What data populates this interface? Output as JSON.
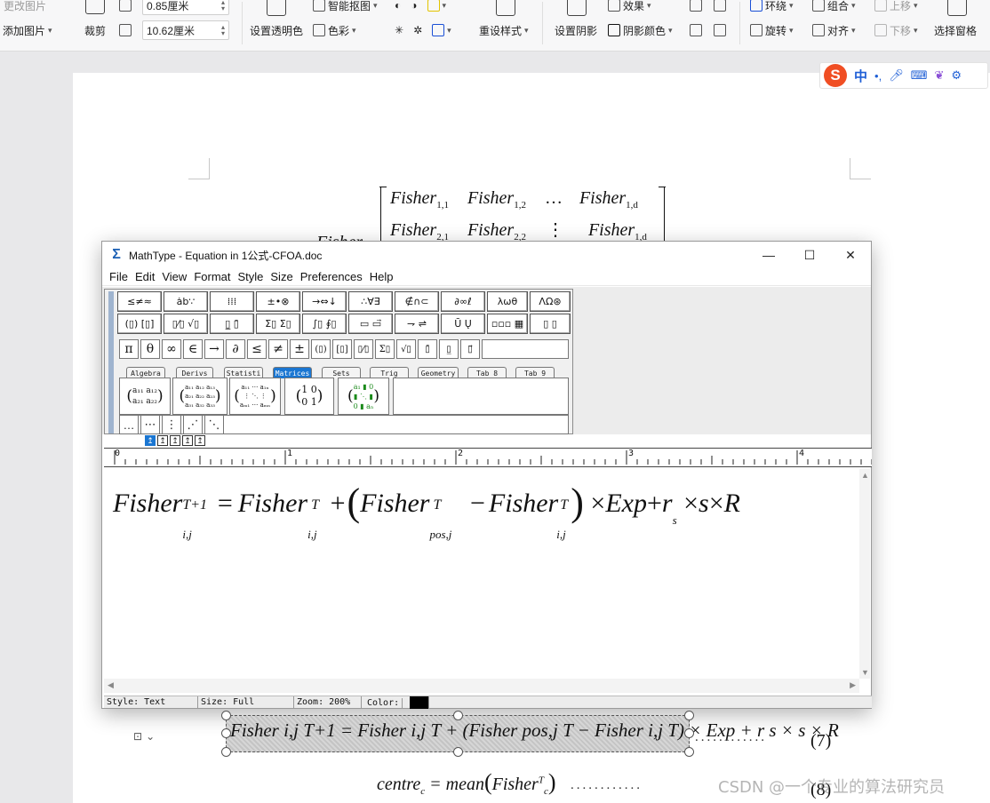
{
  "ribbon": {
    "change_image": "更改图片",
    "add_image": "添加图片",
    "crop": "裁剪",
    "height_value": "0.85厘米",
    "width_value": "10.62厘米",
    "set_transparent": "设置透明色",
    "smart_cutout": "智能抠图",
    "color": "色彩",
    "reset_style": "重设样式",
    "set_shadow": "设置阴影",
    "effects": "效果",
    "shadow_color": "阴影颜色",
    "wrap": "环绕",
    "group": "组合",
    "move_up": "上移",
    "rotate": "旋转",
    "align": "对齐",
    "move_down": "下移",
    "selection_pane": "选择窗格"
  },
  "sogou": {
    "logo": "S",
    "lang": "中",
    "punct": "•,",
    "icons": [
      "mic-icon",
      "keyboard-icon",
      "skin-icon",
      "toolbox-icon"
    ]
  },
  "document": {
    "matrix_row1": [
      "Fisher",
      "1,1",
      "Fisher",
      "1,2",
      "…",
      "Fisher",
      "1,d"
    ],
    "matrix_row2": [
      "Fisher",
      "2,1",
      "Fisher",
      "2,2",
      "⋮",
      "Fisher",
      "1,d"
    ],
    "partial_left": "Fisher",
    "eq7_number": "(7)",
    "eq8_text": "centre",
    "eq8_sub": "c",
    "eq8_mean": "= mean",
    "eq8_fisher": "Fisher",
    "eq8_sup": "T",
    "eq8_sub2": "c",
    "eq8_number": "(8)",
    "dots": "............"
  },
  "mathtype": {
    "title": "MathType - Equation in 1公式-CFOA.doc",
    "menu": [
      "File",
      "Edit",
      "View",
      "Format",
      "Style",
      "Size",
      "Preferences",
      "Help"
    ],
    "palette_row1": [
      "≤≠≈",
      "ȧb∵",
      "⁞⁞⁞",
      "±•⊗",
      "→⇔↓",
      "∴∀∃",
      "∉∩⊂",
      "∂∞ℓ",
      "λωθ",
      "ΛΩ⊛"
    ],
    "palette_row2": [
      "(▯) [▯]",
      "▯⁄▯ √▯",
      "▯̲ ▯̄",
      "Σ▯ Σ▯",
      "∫▯ ∮▯",
      "▭ ▭⃗",
      "⇁ ⇌",
      "Ū Ų",
      "▫▫▫ ▦",
      "▯ ▯"
    ],
    "symbols": [
      "π",
      "θ",
      "∞",
      "∈",
      "→",
      "∂",
      "≤",
      "≠",
      "±",
      "(▯)",
      "[▯]",
      "▯⁄▯",
      "Σ▯",
      "√▯",
      "▯̄",
      "▯̲",
      "▯⃗"
    ],
    "tabs": [
      "Algebra",
      "Derivs",
      "Statisti",
      "Matrices",
      "Sets",
      "Trig",
      "Geometry",
      "Tab 8",
      "Tab 9"
    ],
    "active_tab": "Matrices",
    "templates": [
      "a11 a12 / a21 a22",
      "a11 a12 a13 / a21 a22 a23 / a31 a32 a33",
      "a11 … a1n / ⋮ ⋱ ⋮ / am1 … amn",
      "1 0 / 0 1",
      "a1 0 / ⋱ / 0 an"
    ],
    "dots_row": [
      "…",
      "⋯",
      "⋮",
      "⋰",
      "⋱"
    ],
    "ruler_labels": [
      "0",
      "1",
      "2",
      "3",
      "4"
    ],
    "equation": {
      "lhs_base": "Fisher",
      "lhs_sup": "T+1",
      "lhs_sub": "i,j",
      "eq": "=",
      "t1_base": "Fisher",
      "t1_sup": "T",
      "t1_sub": "i,j",
      "plus1": "+",
      "t2_base": "Fisher",
      "t2_sup": "T",
      "t2_sub": "pos,j",
      "minus": "−",
      "t3_base": "Fisher",
      "t3_sup": "T",
      "t3_sub": "i,j",
      "times1": "×",
      "exp": "Exp",
      "plus2": "+",
      "r": "r",
      "r_sub": "s",
      "times2": "×",
      "s": "s",
      "times3": "×",
      "R": "R"
    },
    "status": {
      "style": "Style: Text",
      "size": "Size: Full",
      "zoom": "Zoom: 200%",
      "color": "Color:"
    },
    "controls": {
      "minimize": "—",
      "maximize": "☐",
      "close": "✕"
    }
  },
  "selected_eq": "Fisher i,j T+1 = Fisher i,j T + (Fisher pos,j T − Fisher i,j T) × Exp + r s × s × R",
  "watermark": "CSDN @一个专业的算法研究员",
  "colors": {
    "accent": "#1a76d2",
    "sogou": "#f04e23"
  }
}
